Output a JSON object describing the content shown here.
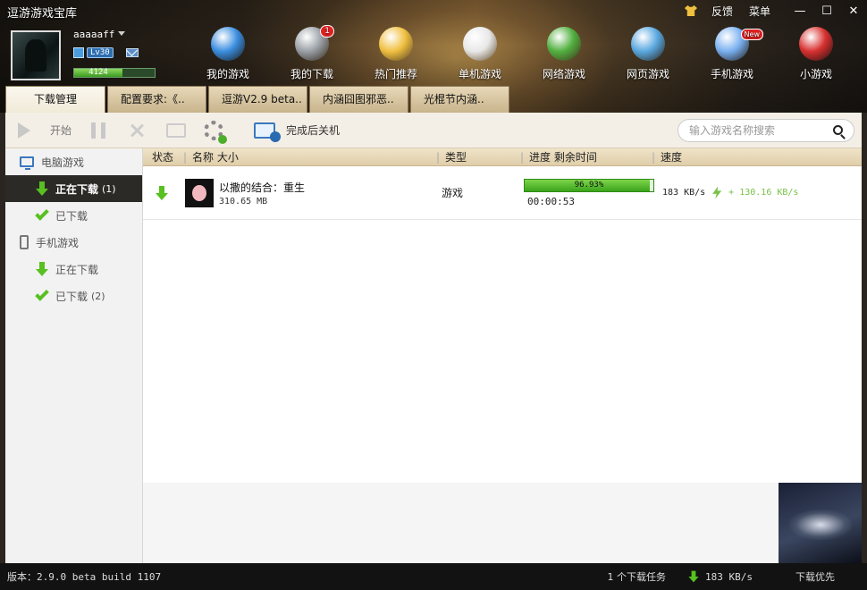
{
  "app": {
    "title": "逗游游戏宝库"
  },
  "top_links": {
    "feedback": "反馈",
    "menu": "菜单",
    "minimize": "—",
    "maximize": "☐",
    "close": "✕"
  },
  "user": {
    "name": "aaaaaff",
    "level": "Lv30",
    "exp_value": "4124",
    "exp_fraction": 0.6
  },
  "nav": [
    {
      "label": "我的游戏",
      "icon": "my-games-icon",
      "color": "#3b8ee0"
    },
    {
      "label": "我的下载",
      "icon": "download-gear-icon",
      "color": "#9aa0a6",
      "badge": "1"
    },
    {
      "label": "热门推荐",
      "icon": "hot-plus-icon",
      "color": "#f0c040"
    },
    {
      "label": "单机游戏",
      "icon": "gamepad-icon",
      "color": "#e8e8e8"
    },
    {
      "label": "网络游戏",
      "icon": "globe-icon",
      "color": "#52b040"
    },
    {
      "label": "网页游戏",
      "icon": "web-game-icon",
      "color": "#5aa8e0"
    },
    {
      "label": "手机游戏",
      "icon": "phone-icon",
      "color": "#7ab0f0",
      "badge_new": "New"
    },
    {
      "label": "小游戏",
      "icon": "joystick-icon",
      "color": "#d83030"
    }
  ],
  "tabs": [
    "下载管理",
    "配置要求:《..",
    "逗游V2.9 beta..",
    "内涵囧图邪恶..",
    "光棍节内涵.."
  ],
  "toolbar": {
    "start": "开始",
    "shutdown_after": "完成后关机",
    "search_placeholder": "输入游戏名称搜索"
  },
  "sidebar": {
    "pc_games": "电脑游戏",
    "pc_downloading": "正在下载",
    "pc_downloading_count": "(1)",
    "pc_downloaded": "已下载",
    "mobile_games": "手机游戏",
    "mobile_downloading": "正在下载",
    "mobile_downloaded": "已下载",
    "mobile_downloaded_count": "(2)"
  },
  "table": {
    "headers": {
      "status": "状态",
      "name_size": "名称 大小",
      "type": "类型",
      "progress": "进度 剩余时间",
      "speed": "速度"
    },
    "rows": [
      {
        "name": "以撒的结合：重生",
        "size": "310.65 MB",
        "type": "游戏",
        "progress_text": "96.93%",
        "progress_fraction": 0.9693,
        "remaining": "00:00:53",
        "speed": "183 KB/s",
        "boost": "+ 130.16 KB/s"
      }
    ]
  },
  "status_bar": {
    "version": "版本：2.9.0 beta build 1107",
    "tasks": "1 个下载任务",
    "speed": "183 KB/s",
    "priority": "下载优先"
  }
}
